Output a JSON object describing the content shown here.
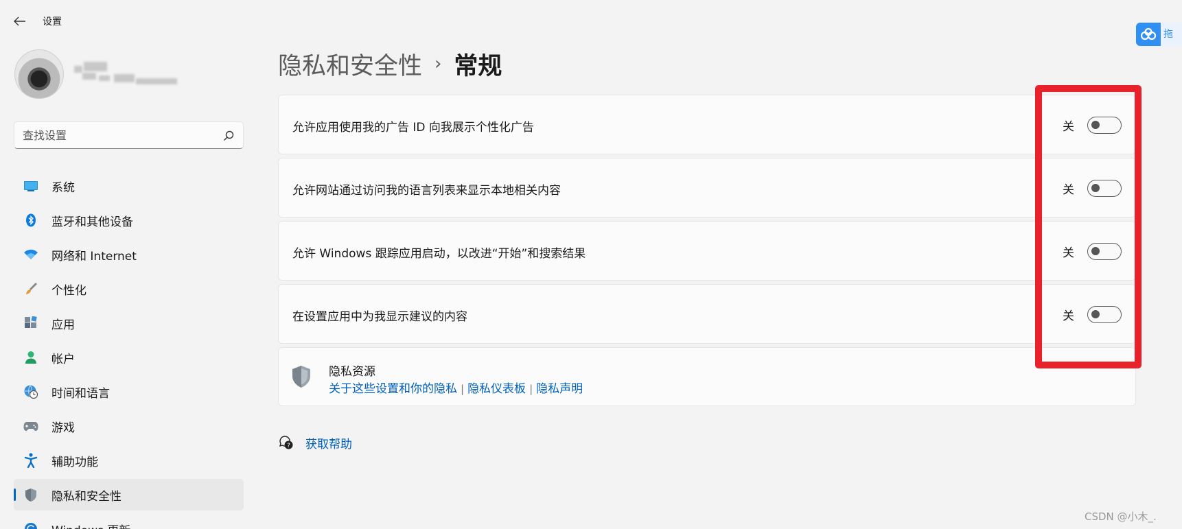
{
  "window": {
    "title": "设置"
  },
  "search": {
    "placeholder": "查找设置"
  },
  "sidebar": {
    "items": [
      {
        "label": "系统",
        "icon": "monitor-icon"
      },
      {
        "label": "蓝牙和其他设备",
        "icon": "bluetooth-icon"
      },
      {
        "label": "网络和 Internet",
        "icon": "wifi-icon"
      },
      {
        "label": "个性化",
        "icon": "brush-icon"
      },
      {
        "label": "应用",
        "icon": "apps-icon"
      },
      {
        "label": "帐户",
        "icon": "person-icon"
      },
      {
        "label": "时间和语言",
        "icon": "globe-clock-icon"
      },
      {
        "label": "游戏",
        "icon": "gamepad-icon"
      },
      {
        "label": "辅助功能",
        "icon": "accessibility-icon"
      },
      {
        "label": "隐私和安全性",
        "icon": "shield-icon",
        "active": true
      },
      {
        "label": "Windows 更新",
        "icon": "update-icon"
      }
    ]
  },
  "breadcrumb": {
    "parent": "隐私和安全性",
    "separator": "›",
    "current": "常规"
  },
  "settings": [
    {
      "label": "允许应用使用我的广告 ID 向我展示个性化广告",
      "state": "关",
      "on": false
    },
    {
      "label": "允许网站通过访问我的语言列表来显示本地相关内容",
      "state": "关",
      "on": false
    },
    {
      "label": "允许 Windows 跟踪应用启动，以改进“开始”和搜索结果",
      "state": "关",
      "on": false
    },
    {
      "label": "在设置应用中为我显示建议的内容",
      "state": "关",
      "on": false
    }
  ],
  "resources": {
    "title": "隐私资源",
    "links": [
      "关于这些设置和你的隐私",
      "隐私仪表板",
      "隐私声明"
    ],
    "separator": "|"
  },
  "help": {
    "label": "获取帮助"
  },
  "overlay": {
    "corner_text": "拖",
    "watermark": "CSDN @小木_."
  },
  "colors": {
    "accent": "#0067c0",
    "link": "#0060b8",
    "highlight": "#e8212b",
    "background": "#f3f3f3",
    "card": "#fbfbfb"
  }
}
